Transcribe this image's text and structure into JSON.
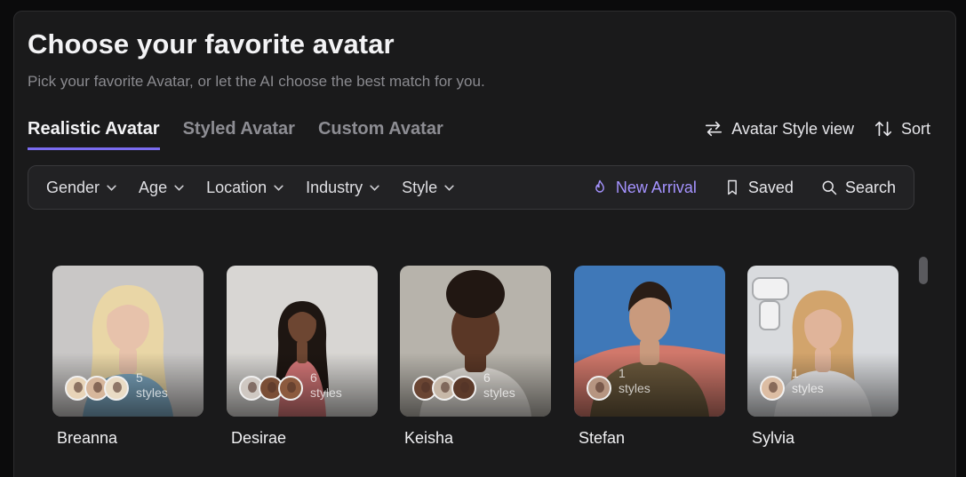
{
  "header": {
    "title": "Choose your favorite avatar",
    "subtitle": "Pick your favorite Avatar, or let the AI choose the best match for you."
  },
  "tabs": [
    {
      "label": "Realistic Avatar",
      "active": true
    },
    {
      "label": "Styled Avatar",
      "active": false
    },
    {
      "label": "Custom Avatar",
      "active": false
    }
  ],
  "tools": {
    "style_view_label": "Avatar Style view",
    "sort_label": "Sort"
  },
  "filters": [
    {
      "label": "Gender"
    },
    {
      "label": "Age"
    },
    {
      "label": "Location"
    },
    {
      "label": "Industry"
    },
    {
      "label": "Style"
    }
  ],
  "actions": {
    "new_arrival_label": "New Arrival",
    "saved_label": "Saved",
    "search_label": "Search"
  },
  "avatars": [
    {
      "name": "Breanna",
      "styles_count": "5",
      "styles_word": "styles",
      "bg": "#c9c7c6",
      "skin": "#e7c2ab",
      "hair": "#e9d6a6",
      "cloth": "#7ea9c3",
      "minis": [
        "#e8d4b8",
        "#d7b79c",
        "#eadcc5"
      ]
    },
    {
      "name": "Desirae",
      "styles_count": "6",
      "styles_word": "styles",
      "bg": "#d8d6d3",
      "skin": "#6d4632",
      "hair": "#1e1612",
      "cloth": "#d77879",
      "minis": [
        "#cfc8c2",
        "#7a4e36",
        "#8c5a3e"
      ]
    },
    {
      "name": "Keisha",
      "styles_count": "6",
      "styles_word": "styles",
      "bg": "#b7b3ab",
      "skin": "#5a3726",
      "hair": "#211712",
      "cloth": "#e6e2dc",
      "minis": [
        "#6a4533",
        "#c7b8a8",
        "#5c3a2a"
      ]
    },
    {
      "name": "Stefan",
      "styles_count": "1",
      "styles_word": "styles",
      "bg": "#3f78b8",
      "skin": "#c99a7d",
      "hair": "#2a1d16",
      "cloth": "#6c5a3d",
      "minis": [
        "#b69581"
      ]
    },
    {
      "name": "Sylvia",
      "styles_count": "1",
      "styles_word": "styles",
      "bg": "#d9dbde",
      "skin": "#e0b49a",
      "hair": "#d2a46c",
      "cloth": "#f4f4f6",
      "minis": [
        "#dcbda3"
      ]
    }
  ]
}
